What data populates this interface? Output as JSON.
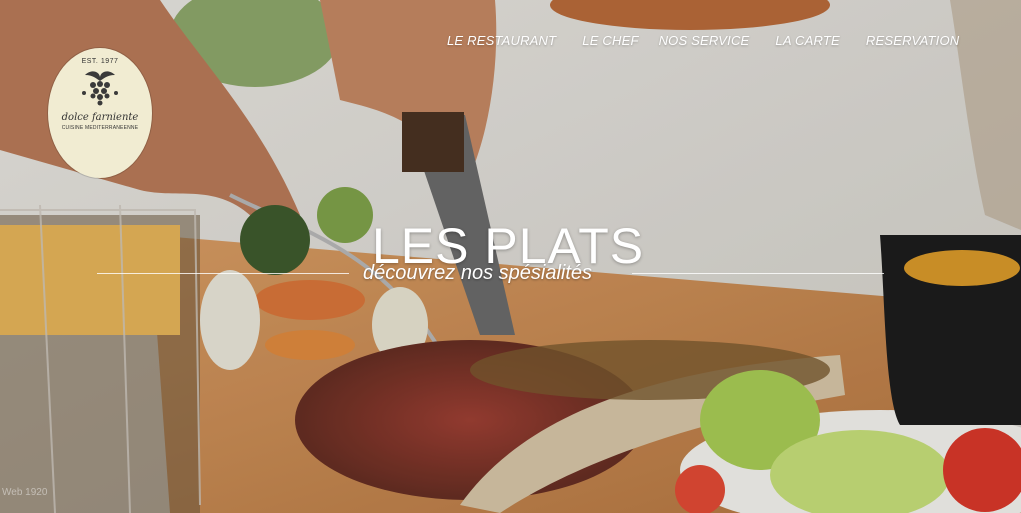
{
  "nav": {
    "items": [
      "LE RESTAURANT",
      "LE CHEF",
      "NOS SERVICE",
      "LA CARTE",
      "RESERVATION"
    ]
  },
  "logo": {
    "est": "EST. 1977",
    "name": "dolce farniente",
    "subtitle": "CUISINE MEDITERRANEENNE"
  },
  "hero": {
    "title": "LES PLATS",
    "subtitle": "découvrez nos spésialités",
    "watermark": "Web 1920"
  },
  "colors": {
    "nav_text": "#ffffff",
    "logo_bg": "#f1ecd2",
    "table_cloth": "#ecebe8",
    "board": "#c98a52"
  }
}
